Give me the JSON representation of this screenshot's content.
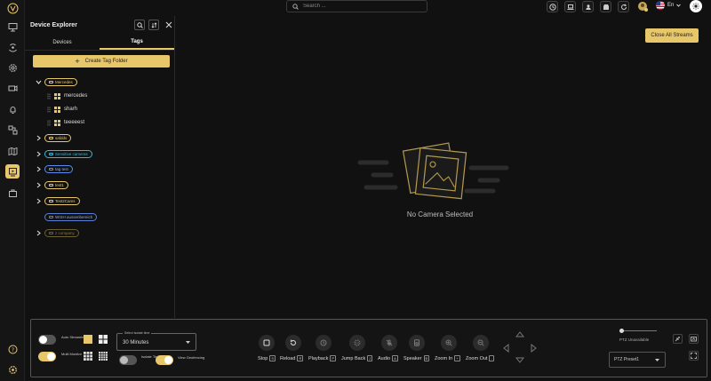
{
  "topbar": {
    "search_placeholder": "Search ...",
    "language": "En"
  },
  "explorer": {
    "title": "Device Explorer",
    "tabs": [
      {
        "label": "Devices",
        "active": false
      },
      {
        "label": "Tags",
        "active": true
      }
    ],
    "create_button": "Create Tag Folder",
    "tags": [
      {
        "name": "Mercedes",
        "color": "#e8c76a",
        "expanded": true,
        "devices": [
          "mercedes",
          "sharh",
          "teeeeest"
        ]
      },
      {
        "name": "safdds",
        "color": "#e8c76a",
        "expanded": false
      },
      {
        "name": "Sensitive cameras",
        "color": "#3ab7d6",
        "expanded": false
      },
      {
        "name": "tag test",
        "color": "#5a8dee",
        "expanded": false
      },
      {
        "name": "test1",
        "color": "#e8c76a",
        "expanded": false
      },
      {
        "name": "Test2Cams",
        "color": "#e8c76a",
        "expanded": false
      },
      {
        "name": "WISH aussenbereich",
        "color": "#5a7fd6",
        "expanded": null
      },
      {
        "name": "z company",
        "color": "#8a7a3a",
        "expanded": false
      }
    ]
  },
  "main": {
    "close_all": "Close All Streams",
    "empty_text": "No Camera Selected"
  },
  "controls": {
    "auto_streaming": "Auto Streaming",
    "multi_monitor": "Multi Monitor",
    "isolate_time_caption": "Select isolate time",
    "isolate_time_value": "30 Minutes",
    "isolate_time": "Isolate Time",
    "view_geofencing": "View Geofencing",
    "buttons": [
      {
        "label": "Stop",
        "key": "S"
      },
      {
        "label": "Reload",
        "key": "R"
      },
      {
        "label": "Playback",
        "key": "P"
      },
      {
        "label": "Jump Back",
        "key": "J"
      },
      {
        "label": "Audio",
        "key": "A"
      },
      {
        "label": "Speaker",
        "key": "B"
      },
      {
        "label": "Zoom In",
        "key": "+"
      },
      {
        "label": "Zoom Out",
        "key": "-"
      }
    ],
    "ptz_status": "PTZ Unavailable",
    "ptz_preset": "PTZ Preset1"
  },
  "colors": {
    "accent": "#e8c76a",
    "background": "#111111"
  }
}
